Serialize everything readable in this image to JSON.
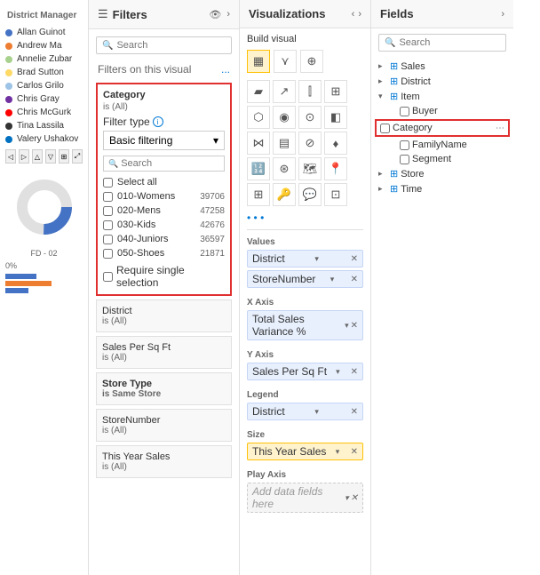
{
  "leftPanel": {
    "title": "District Manager",
    "managers": [
      {
        "name": "Allan Guinot",
        "color": "#4472c4"
      },
      {
        "name": "Andrew Ma",
        "color": "#ed7d31"
      },
      {
        "name": "Annelie Zubar",
        "color": "#a9d18e"
      },
      {
        "name": "Brad Sutton",
        "color": "#ffd966"
      },
      {
        "name": "Carlos Grilo",
        "color": "#9dc3e6"
      },
      {
        "name": "Chris Gray",
        "color": "#7030a0"
      },
      {
        "name": "Chris McGurk",
        "color": "#ff0000"
      },
      {
        "name": "Tina Lassila",
        "color": "#333333"
      },
      {
        "name": "Valery Ushakov",
        "color": "#0070c0"
      }
    ],
    "chartLabel": "FD - 02",
    "percentLabel": "0%"
  },
  "filtersPanel": {
    "title": "Filters",
    "searchPlaceholder": "Search",
    "filtersOnThisVisual": "Filters on this visual",
    "moreLabel": "...",
    "categoryFilter": {
      "title": "Category",
      "subtitle": "is (All)",
      "filterTypeLabel": "Filter type",
      "filterTypeValue": "Basic filtering",
      "searchPlaceholder": "Search",
      "selectAllLabel": "Select all",
      "items": [
        {
          "label": "010-Womens",
          "value": "39706"
        },
        {
          "label": "020-Mens",
          "value": "47258"
        },
        {
          "label": "030-Kids",
          "value": "42676"
        },
        {
          "label": "040-Juniors",
          "value": "36597"
        },
        {
          "label": "050-Shoes",
          "value": "21871"
        }
      ],
      "requireSingleSelection": "Require single selection"
    },
    "districtFilter": {
      "title": "District",
      "subtitle": "is (All)"
    },
    "salesFilter": {
      "title": "Sales Per Sq Ft",
      "subtitle": "is (All)"
    },
    "storeTypeFilter": {
      "title": "Store Type",
      "subtitle": "is Same Store",
      "subtitleBold": true
    },
    "storeNumberFilter": {
      "title": "StoreNumber",
      "subtitle": "is (All)"
    },
    "thisYearSalesFilter": {
      "title": "This Year Sales",
      "subtitle": "is (All)"
    }
  },
  "vizPanel": {
    "title": "Visualizations",
    "buildVisual": "Build visual",
    "fieldSections": [
      {
        "label": "Values",
        "pills": [
          {
            "text": "District",
            "type": "normal"
          },
          {
            "text": "StoreNumber",
            "type": "normal"
          }
        ]
      },
      {
        "label": "X Axis",
        "pills": [
          {
            "text": "Total Sales Variance %",
            "type": "normal"
          }
        ]
      },
      {
        "label": "Y Axis",
        "pills": [
          {
            "text": "Sales Per Sq Ft",
            "type": "normal"
          }
        ]
      },
      {
        "label": "Legend",
        "pills": [
          {
            "text": "District",
            "type": "normal"
          }
        ]
      },
      {
        "label": "Size",
        "pills": [
          {
            "text": "This Year Sales",
            "type": "yellow"
          }
        ]
      },
      {
        "label": "Play Axis",
        "pills": [
          {
            "text": "Add data fields here",
            "type": "empty"
          }
        ]
      }
    ]
  },
  "fieldsPanel": {
    "title": "Fields",
    "searchPlaceholder": "Search",
    "tree": [
      {
        "label": "Sales",
        "icon": "table",
        "expanded": false
      },
      {
        "label": "District",
        "icon": "table",
        "expanded": false
      },
      {
        "label": "Item",
        "icon": "table",
        "expanded": true,
        "children": [
          {
            "label": "Buyer",
            "hasCheckbox": true
          },
          {
            "label": "Category",
            "hasCheckbox": true,
            "highlighted": true
          },
          {
            "label": "FamilyName",
            "hasCheckbox": true
          },
          {
            "label": "Segment",
            "hasCheckbox": true
          }
        ]
      },
      {
        "label": "Store",
        "icon": "table",
        "expanded": false
      },
      {
        "label": "Time",
        "icon": "table",
        "expanded": false
      }
    ]
  }
}
